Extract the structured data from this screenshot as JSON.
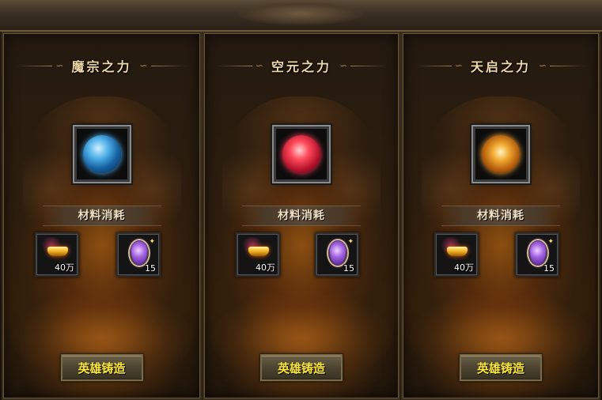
{
  "panels": [
    {
      "title": "魔宗之力",
      "orb_icon": "blue-crystal-orb-icon",
      "orb_color": "#4fb0e8",
      "material_label": "材料消耗",
      "materials": [
        {
          "icon": "gold-ingot-icon",
          "quantity": "40万"
        },
        {
          "icon": "purple-gem-icon",
          "quantity": "15"
        }
      ],
      "button_label": "英雄铸造"
    },
    {
      "title": "空元之力",
      "orb_icon": "red-crystal-orb-icon",
      "orb_color": "#ff4a5a",
      "material_label": "材料消耗",
      "materials": [
        {
          "icon": "gold-ingot-icon",
          "quantity": "40万"
        },
        {
          "icon": "purple-gem-icon",
          "quantity": "15"
        }
      ],
      "button_label": "英雄铸造"
    },
    {
      "title": "天启之力",
      "orb_icon": "golden-figure-orb-icon",
      "orb_color": "#f0a830",
      "material_label": "材料消耗",
      "materials": [
        {
          "icon": "gold-ingot-icon",
          "quantity": "40万"
        },
        {
          "icon": "purple-gem-icon",
          "quantity": "15"
        }
      ],
      "button_label": "英雄铸造"
    }
  ],
  "colors": {
    "title_text": "#f0d9a8",
    "button_text": "#ffe838",
    "panel_glow": "#d67614"
  }
}
